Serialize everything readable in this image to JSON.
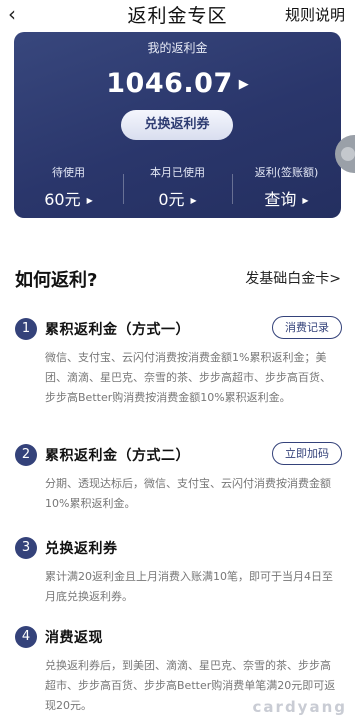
{
  "nav": {
    "back_icon": "chevron-left-icon",
    "title": "返利金专区",
    "rules_label": "规则说明"
  },
  "card": {
    "label": "我的返利金",
    "amount": "1046.07",
    "redeem_label": "兑换返利券",
    "stats": [
      {
        "label": "待使用",
        "value": "60元"
      },
      {
        "label": "本月已使用",
        "value": "0元"
      },
      {
        "label": "返利(签账额)",
        "value": "查询"
      }
    ],
    "colors": {
      "background": "#2a366b",
      "button": "#eef1fa"
    }
  },
  "how": {
    "title": "如何返利?",
    "link": "发基础白金卡>"
  },
  "steps": [
    {
      "num": "1",
      "title": "累积返利金（方式一）",
      "button": "消费记录",
      "desc": "微信、支付宝、云闪付消费按消费金额1%累积返利金；美团、滴滴、星巴克、奈雪的茶、步步高超市、步步高百货、步步高Better购消费按消费金额10%累积返利金。"
    },
    {
      "num": "2",
      "title": "累积返利金（方式二）",
      "button": "立即加码",
      "desc": "分期、透现达标后，微信、支付宝、云闪付消费按消费金额10%累积返利金。"
    },
    {
      "num": "3",
      "title": "兑换返利券",
      "desc": "累计满20返利金且上月消费入账满10笔，即可于当月4日至月底兑换返利券。"
    },
    {
      "num": "4",
      "title": "消费返现",
      "desc": "兑换返利券后，到美团、滴滴、星巴克、奈雪的茶、步步高超市、步步高百货、步步高Better购消费单笔满20元即可返现20元。"
    }
  ],
  "watermark": "cardyang",
  "accent_color": "#34427a"
}
